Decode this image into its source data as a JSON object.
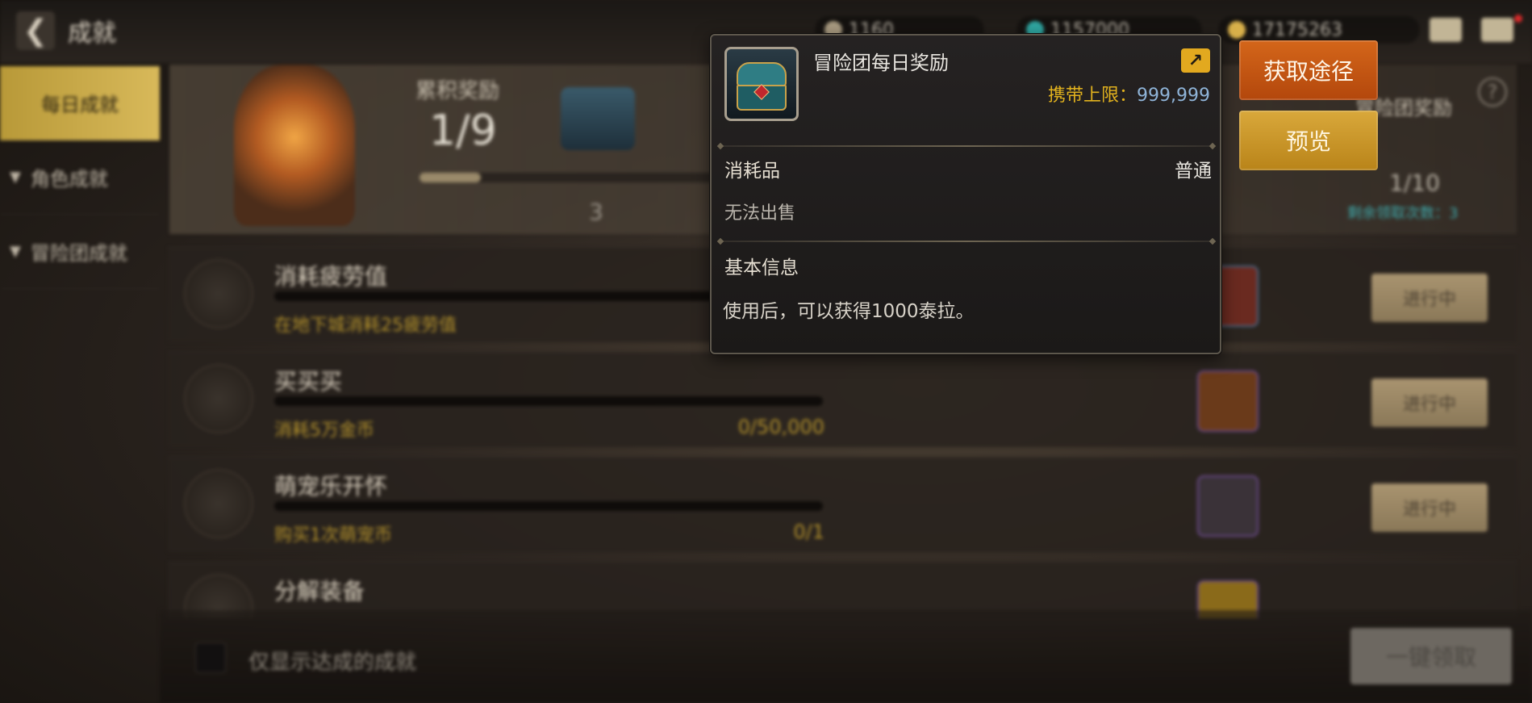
{
  "top_bar": {
    "back_label": "成就",
    "currency_1": "1160",
    "currency_2": "1157000",
    "currency_3": "17175263"
  },
  "sidebar": {
    "items": [
      {
        "label": "每日成就",
        "active": true
      },
      {
        "label": "角色成就",
        "active": false
      },
      {
        "label": "冒险团成就",
        "active": false
      }
    ]
  },
  "header": {
    "cumulative_label": "累积奖励",
    "cumulative_value": "1/9",
    "milestone_count": "3",
    "right_title": "冒险团奖励",
    "right_count": "1/10",
    "remaining_text": "剩余领取次数：3"
  },
  "achievements": [
    {
      "title": "消耗疲劳值",
      "desc": "在地下城消耗25疲劳值",
      "progress": "",
      "button": "进行中"
    },
    {
      "title": "买买买",
      "desc": "消耗5万金币",
      "progress": "0/50,000",
      "button": "进行中"
    },
    {
      "title": "萌宠乐开怀",
      "desc": "购买1次萌宠币",
      "progress": "0/1",
      "button": "进行中"
    },
    {
      "title": "分解装备",
      "desc": "",
      "progress": "",
      "button": ""
    }
  ],
  "bottom": {
    "filter_label": "仅显示达成的成就",
    "claim_all": "一键领取"
  },
  "popup": {
    "item_name": "冒险团每日奖励",
    "carry_label": "携带上限：",
    "carry_value": "999,999",
    "type": "消耗品",
    "grade": "普通",
    "sell_text": "无法出售",
    "basic_info_head": "基本信息",
    "basic_info_text": "使用后，可以获得1000泰拉。",
    "share_icon": "share-icon"
  },
  "actions": {
    "get_source": "获取途径",
    "preview": "预览"
  },
  "colors": {
    "accent_gold": "#e2b21e",
    "value_blue": "#8fb4d8",
    "button_orange": "#c9581a",
    "button_gold": "#c9951f"
  }
}
